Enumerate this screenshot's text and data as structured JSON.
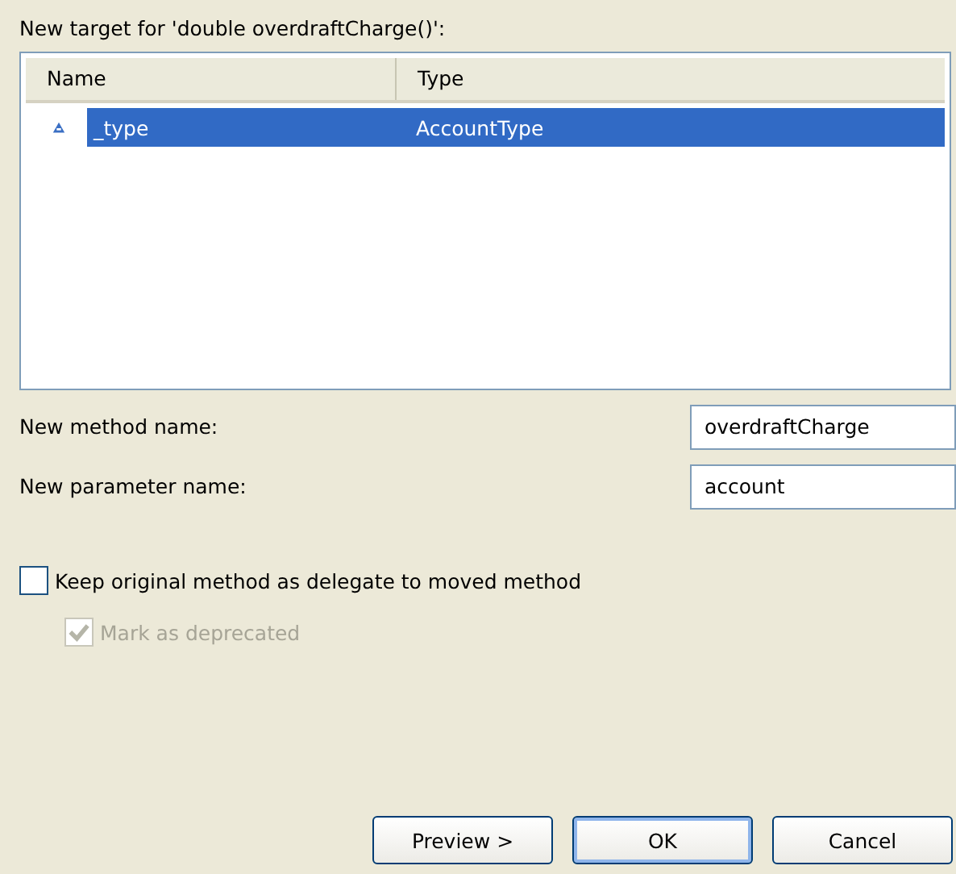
{
  "title": "New target for 'double overdraftCharge()':",
  "table": {
    "columns": [
      "Name",
      "Type"
    ],
    "rows": [
      {
        "name": "_type",
        "type": "AccountType",
        "selected": true
      }
    ]
  },
  "fields": [
    {
      "label": "New method name:",
      "value": "overdraftCharge"
    },
    {
      "label": "New parameter name:",
      "value": "account"
    }
  ],
  "checkboxes": [
    {
      "label": "Keep original method as delegate to moved method",
      "checked": false,
      "disabled": false,
      "children": [
        {
          "label": "Mark as deprecated",
          "checked": true,
          "disabled": true
        }
      ]
    }
  ],
  "buttons": [
    {
      "label": "Preview >",
      "default": false
    },
    {
      "label": "OK",
      "default": true
    },
    {
      "label": "Cancel",
      "default": false
    }
  ]
}
